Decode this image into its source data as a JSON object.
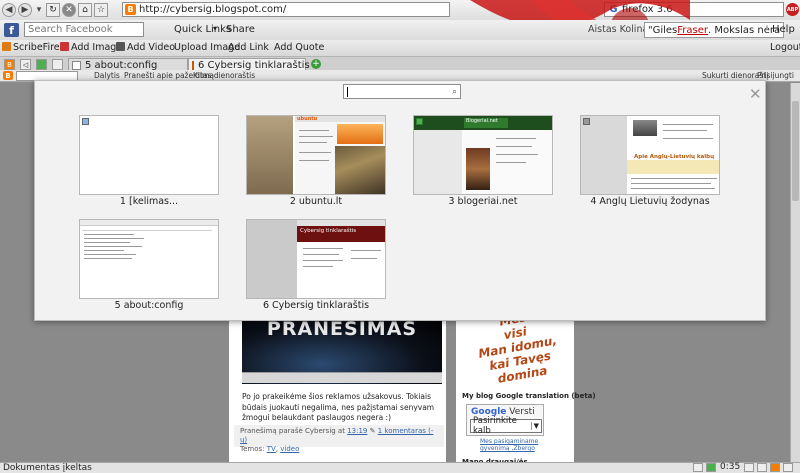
{
  "browser": {
    "url": "http://cybersig.blogspot.com/",
    "search_query": "firefox 3.6",
    "abp_label": "ABP"
  },
  "facebook_toolbar": {
    "search_placeholder": "Search Facebook",
    "quick_links": "Quick Links",
    "share": "Share",
    "friend_text": "Aistas Kolinas",
    "news_prefix": "\"Giles ",
    "news_link": "Fraser",
    "news_suffix": ". Mokslas nėra",
    "help": "Help",
    "logout": "Logout"
  },
  "addon_bar": {
    "scribefire": "ScribeFire",
    "add_image": "Add Image",
    "add_video": "Add Video",
    "upload_image": "Upload Image",
    "add_link": "Add Link",
    "add_quote": "Add Quote"
  },
  "tabs": [
    {
      "label": "5  about:config",
      "active": false
    },
    {
      "label": "6  Cybersig tinklaraštis",
      "active": true
    }
  ],
  "blogger_bar": {
    "share": "Dalytis",
    "report": "Pranešti apie pažeidimą",
    "next_blog": "Kitas dienoraštis",
    "create_blog": "Sukurti dienoraštį",
    "sign_in": "Prisijungti"
  },
  "panorama": {
    "search_value": "",
    "thumbnails": [
      {
        "label": "1  [kelimas..."
      },
      {
        "label": "2  ubuntu.lt"
      },
      {
        "label": "3  blogeriai.net"
      },
      {
        "label": "4  Anglų Lietuvių žodynas"
      },
      {
        "label": "5  about:config"
      },
      {
        "label": "6  Cybersig tinklaraštis"
      }
    ],
    "thumb_text": {
      "ubuntu_logo": "ubuntu",
      "blogeriai_logo": "Blogeriai.net",
      "anglu_title": "Apie Anglų-Lietuvių kalbų žodyną",
      "cybersig_title": "Cybersig tinklaraštis"
    }
  },
  "page": {
    "video_title": "PRANEŠIMAS",
    "post_text": "Po jo prakeikėme šios reklamos užsakovus. Tokiais būdais juokauti negalima, nes pažįstamai senyvam žmogui belaukdant paslaugos negera :)",
    "footer_prefix": "Pranešimą parašė Cybersig at ",
    "footer_time": "13:19",
    "footer_comments": "1 komentaras (-ų)",
    "footer_labels_prefix": "Temos: ",
    "footer_label_1": "TV",
    "footer_label_2": "video",
    "side_art_lines": [
      "Mes",
      "visi",
      "Man idomu,",
      "kai Tavęs domina"
    ],
    "side_heading": "My blog Google translation (beta)",
    "translate_label": "Versti",
    "translate_select": "Pasirinkite kalb",
    "powered_by": "Mes pasigaminame gyvenimą ,Zbergo",
    "side_heading_2": "Mano draugai/ės"
  },
  "status_bar": {
    "text": "Dokumentas įkeltas",
    "time": "0:35"
  }
}
